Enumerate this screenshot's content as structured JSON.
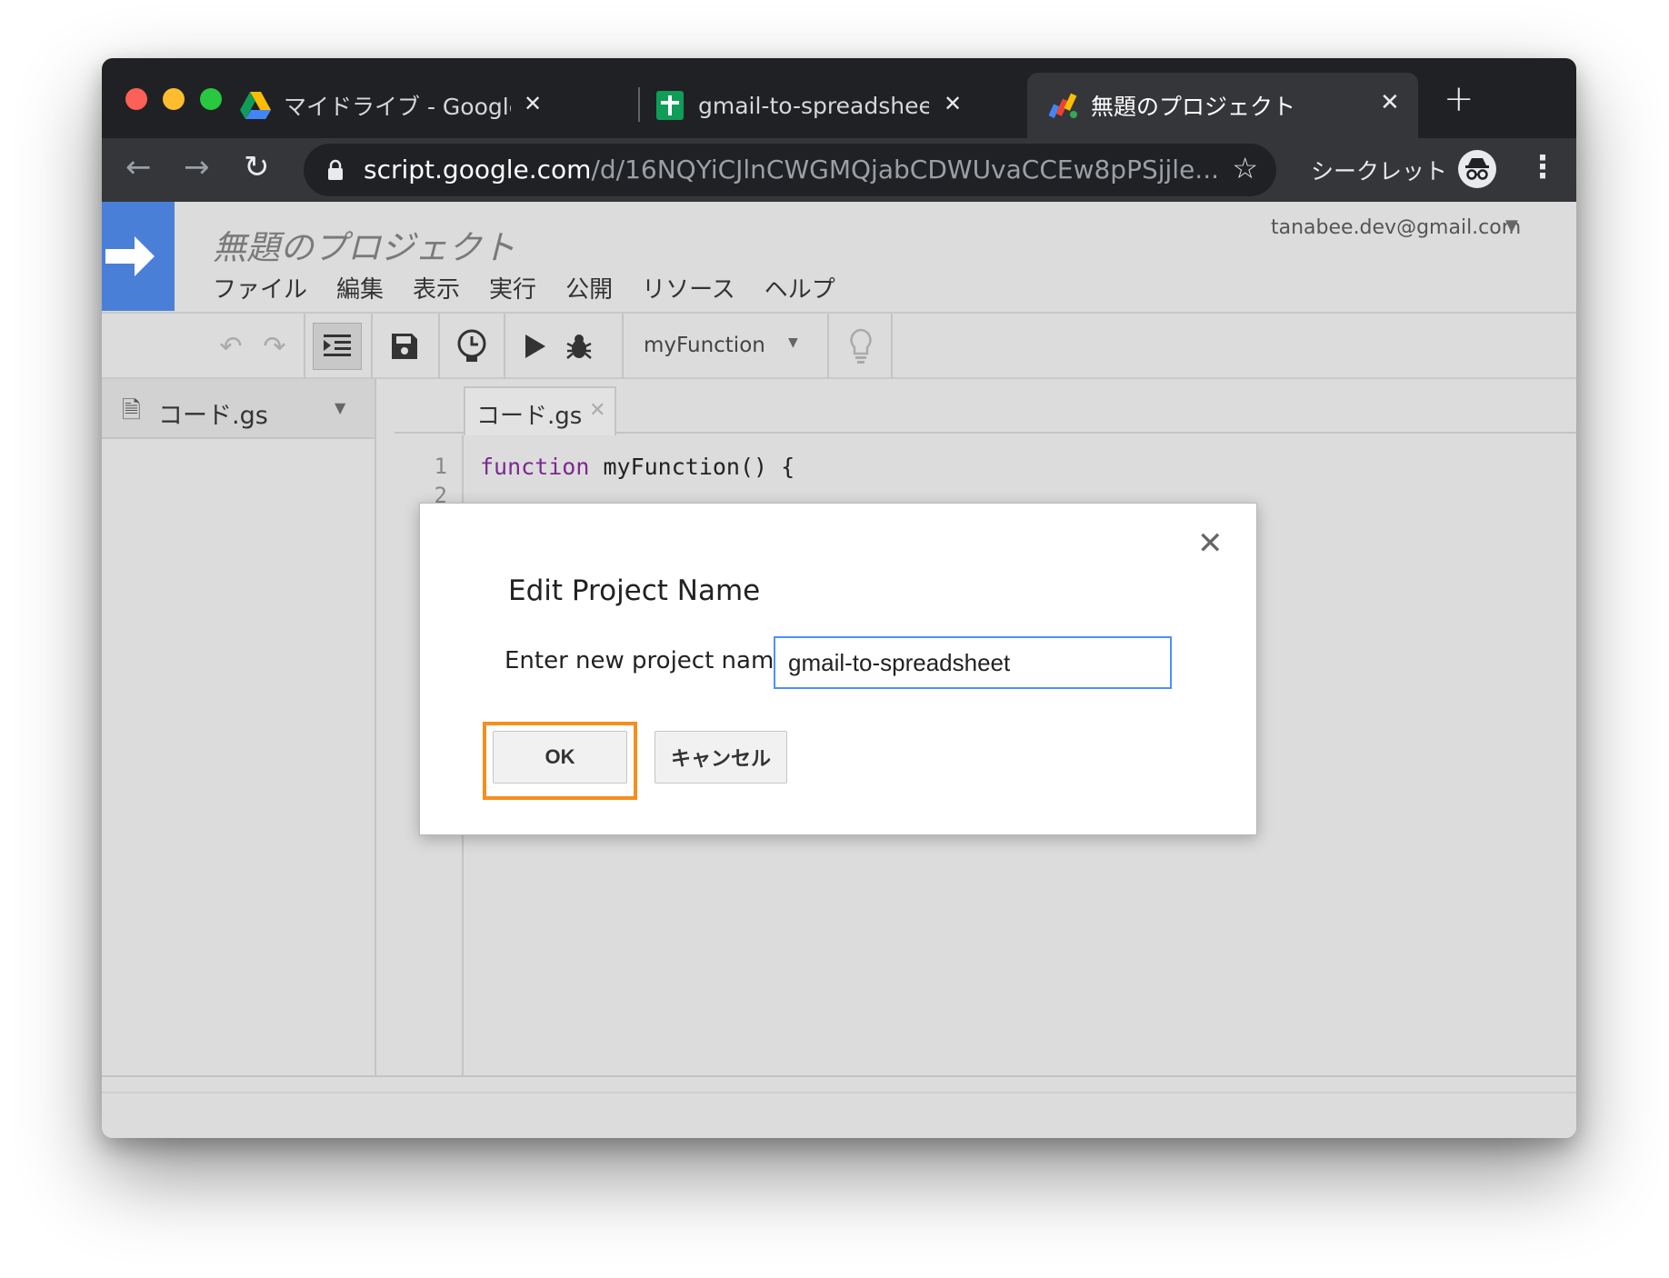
{
  "browser": {
    "tabs": [
      {
        "title": "マイドライブ - Google ドライ",
        "icon": "google-drive-icon",
        "close": "✕"
      },
      {
        "title": "gmail-to-spreadsheet - Goo",
        "icon": "google-sheets-icon",
        "close": "✕"
      },
      {
        "title": "無題のプロジェクト",
        "icon": "apps-script-icon",
        "close": "✕"
      }
    ],
    "new_tab": "+",
    "url_host": "script.google.com",
    "url_path": "/d/16NQYiCJlnCWGMQjabCDWUvaCCEw8pPSjjle...",
    "incognito_label": "シークレット"
  },
  "app": {
    "project_title": "無題のプロジェクト",
    "user_email": "tanabee.dev@gmail.com",
    "menu": [
      "ファイル",
      "編集",
      "表示",
      "実行",
      "公開",
      "リソース",
      "ヘルプ"
    ],
    "function_select": "myFunction",
    "file_name": "コード.gs",
    "editor_tab": "コード.gs",
    "code_lines": [
      {
        "no": "1",
        "keyword": "function",
        "rest": " myFunction() {"
      },
      {
        "no": "2"
      }
    ]
  },
  "dialog": {
    "title": "Edit Project Name",
    "label": "Enter new project name",
    "input_value": "gmail-to-spreadsheet",
    "ok_label": "OK",
    "cancel_label": "キャンセル",
    "close": "✕",
    "highlight_color": "#f68e1e"
  }
}
